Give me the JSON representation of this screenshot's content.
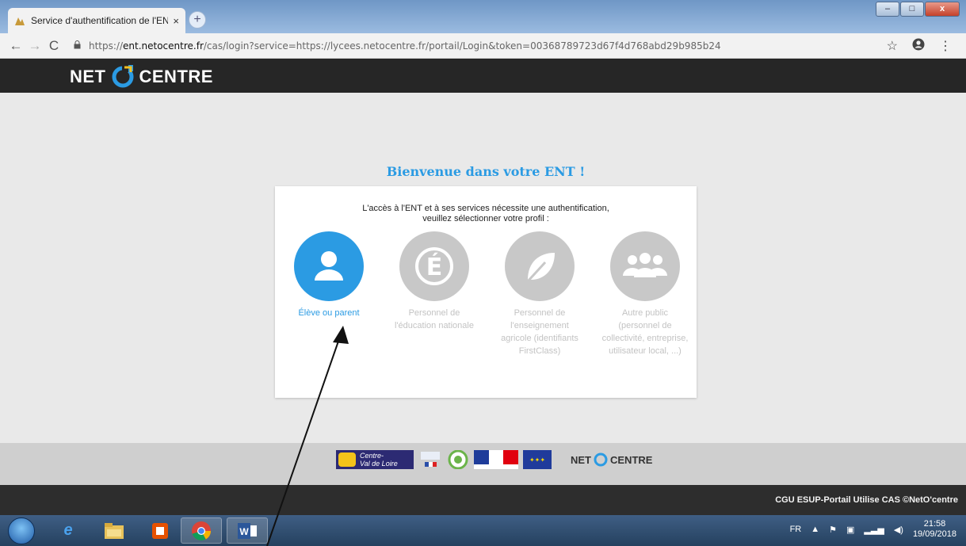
{
  "browser": {
    "tab_title": "Service d'authentification de l'EN",
    "tab_close": "×",
    "new_tab": "+",
    "url_scheme": "https://",
    "url_host": "ent.netocentre.fr",
    "url_rest": "/cas/login?service=https://lycees.netocentre.fr/portail/Login&token=00368789723d67f4d768abd29b985b24",
    "window_controls": {
      "minimize": "–",
      "maximize": "□",
      "close": "x"
    }
  },
  "site": {
    "logo_left": "NET",
    "logo_right": "CENTRE",
    "welcome": "Bienvenue dans votre ENT !",
    "intro_line1": "L'accès à l'ENT et à ses services nécessite une authentification,",
    "intro_line2": "veuillez sélectionner votre profil :",
    "profiles": [
      {
        "label": "Élève ou parent",
        "icon": "person-icon",
        "active": true
      },
      {
        "label": "Personnel de l'éducation nationale",
        "icon": "e-accent-icon",
        "active": false
      },
      {
        "label": "Personnel de l'enseignement agricole (identifiants FirstClass)",
        "icon": "leaf-icon",
        "active": false
      },
      {
        "label": "Autre public (personnel de collectivité, entreprise, utilisateur local, ...)",
        "icon": "group-icon",
        "active": false
      }
    ],
    "footer_links": "CGU ESUP-Portail Utilise CAS ©NetO'centre",
    "partner_region_line1": "Centre-",
    "partner_region_line2": "Val de Loire",
    "partner_netcentre_left": "NET",
    "partner_netcentre_right": "CENTRE"
  },
  "colors": {
    "accent": "#2b9be3",
    "header": "#262626",
    "inactive": "#c8c8c8"
  },
  "taskbar": {
    "language": "FR",
    "time": "21:58",
    "date": "19/09/2018"
  }
}
